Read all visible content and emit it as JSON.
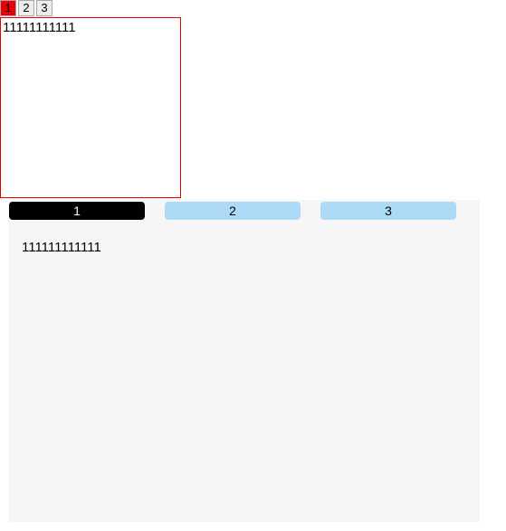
{
  "smallTabs": {
    "items": [
      {
        "label": "1",
        "active": true
      },
      {
        "label": "2",
        "active": false
      },
      {
        "label": "3",
        "active": false
      }
    ]
  },
  "panel": {
    "content": "11111111111"
  },
  "bigTabs": {
    "items": [
      {
        "label": "1",
        "active": true
      },
      {
        "label": "2",
        "active": false
      },
      {
        "label": "3",
        "active": false
      }
    ]
  },
  "bigPanel": {
    "content": "111111111111"
  }
}
